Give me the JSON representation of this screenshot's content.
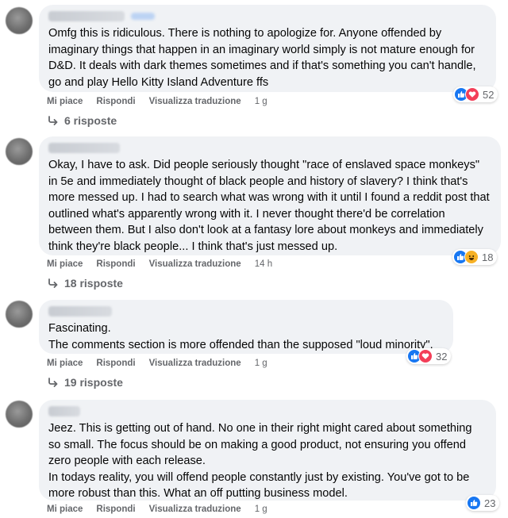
{
  "labels": {
    "like": "Mi piace",
    "reply": "Rispondi",
    "translate": "Visualizza traduzione"
  },
  "comments": [
    {
      "text": "Omfg this is ridiculous. There is nothing to apologize for. Anyone offended by imaginary things that happen in an imaginary world simply is not mature enough for D&D. It deals with dark themes sometimes and if that's something you can't handle, go and play Hello Kitty Island Adventure ffs",
      "reactions": [
        "like",
        "love"
      ],
      "reaction_count": "52",
      "time": "1 g",
      "replies": "6 risposte"
    },
    {
      "text": "Okay, I have to ask. Did people seriously thought \"race of enslaved space monkeys\" in 5e and immediately thought of black people and history of slavery? I think that's more messed up. I had to search what was wrong with it until I found a reddit post that outlined what's apparently wrong with it. I never thought there'd be correlation between them. But I also don't look at a fantasy lore about monkeys and immediately think they're black people... I think that's just messed up.",
      "reactions": [
        "like",
        "haha"
      ],
      "reaction_count": "18",
      "time": "14 h",
      "replies": "18 risposte"
    },
    {
      "text": "Fascinating.\nThe comments section is more offended than the supposed \"loud minority\".",
      "reactions": [
        "like",
        "love"
      ],
      "reaction_count": "32",
      "time": "1 g",
      "replies": "19 risposte"
    },
    {
      "text": "Jeez. This is getting out of hand. No one in their right might cared about something so small. The focus should be on making a good product, not ensuring you offend zero people with each release.\nIn todays reality, you will offend people constantly just by existing. You've got to be more robust than this. What an off putting business model.",
      "reactions": [
        "like"
      ],
      "reaction_count": "23",
      "time": "1 g",
      "replies": ""
    }
  ]
}
